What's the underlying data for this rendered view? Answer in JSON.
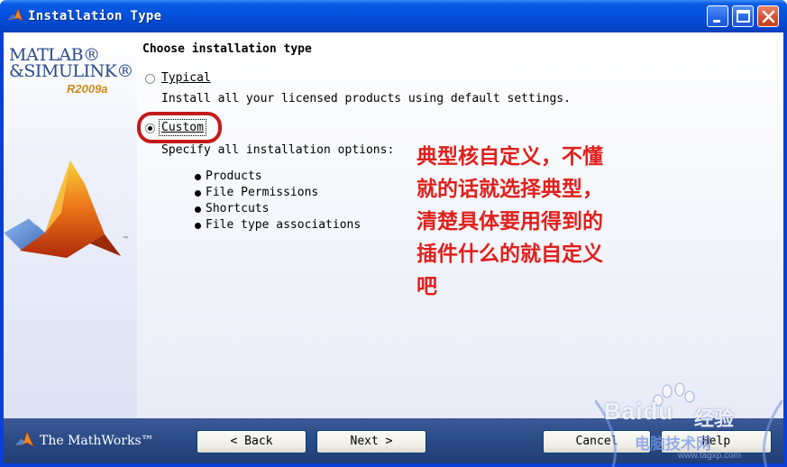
{
  "window": {
    "title": "Installation Type"
  },
  "logo": {
    "line1": "MATLAB®",
    "line2": "&SIMULINK®",
    "version": "R2009a",
    "tm": "™"
  },
  "main": {
    "heading": "Choose installation type",
    "typical": {
      "label": "Typical",
      "description": "Install all your licensed products using default settings.",
      "selected": false
    },
    "custom": {
      "label": "Custom",
      "description": "Specify all installation options:",
      "selected": true,
      "options": [
        "Products",
        "File Permissions",
        "Shortcuts",
        "File type associations"
      ]
    }
  },
  "annotation": {
    "lines": [
      "典型核自定义，不懂",
      "就的话就选择典型，",
      "清楚具体要用得到的",
      "插件什么的就自定义",
      "吧"
    ],
    "color": "#e0201c"
  },
  "footer": {
    "company": "The MathWorks™",
    "back_label": "< Back",
    "next_label": "Next >",
    "cancel_label": "Cancel",
    "help_label": "Help"
  },
  "watermark": {
    "brand": "Baidu",
    "brand_cn": "经验",
    "site_cn": "电脑技术网",
    "url": "www.tagxp.com"
  },
  "colors": {
    "titlebar": "#0551dd",
    "highlight": "#c41a1a",
    "footer": "#2a4a86"
  }
}
